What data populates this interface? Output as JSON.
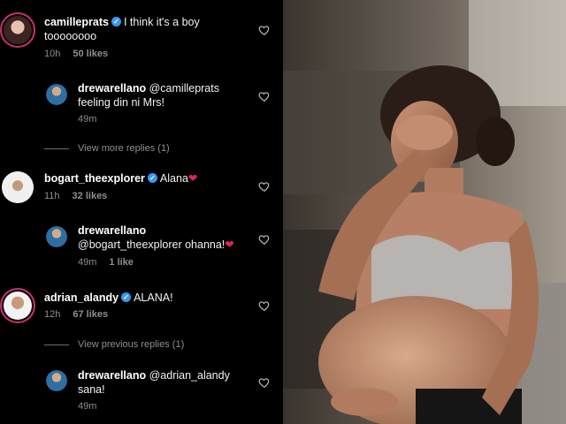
{
  "thread": {
    "c1": {
      "username": "camilleprats",
      "text_1": "I think it's a boy",
      "text_2": "toooooooo",
      "time": "10h",
      "likes": "50 likes"
    },
    "r1": {
      "username": "drewarellano",
      "mention": "@camilleprats",
      "text_2": "feeling din ni Mrs!",
      "time": "49m"
    },
    "view_more_1": "View more replies (1)",
    "c2": {
      "username": "bogart_theexplorer",
      "text": "Alana",
      "emoji": "❤",
      "time": "11h",
      "likes": "32 likes"
    },
    "r2": {
      "username": "drewarellano",
      "mention_text": "@bogart_theexplorer ohanna!",
      "emoji": "❤",
      "time": "49m",
      "likes": "1 like"
    },
    "c3": {
      "username": "adrian_alandy",
      "text": "ALANA!",
      "time": "12h",
      "likes": "67 likes"
    },
    "view_prev": "View previous replies (1)",
    "r3": {
      "username": "drewarellano",
      "mention": "@adrian_alandy",
      "text_2": "sana!",
      "time": "49m"
    }
  },
  "icons": {
    "verified": "verified-badge-icon",
    "like": "heart-outline-icon"
  },
  "colors": {
    "background": "#000000",
    "verified": "#3897f0",
    "heart": "#e0245e",
    "muted": "#8e8e8e",
    "story_ring": "#c9306f"
  }
}
